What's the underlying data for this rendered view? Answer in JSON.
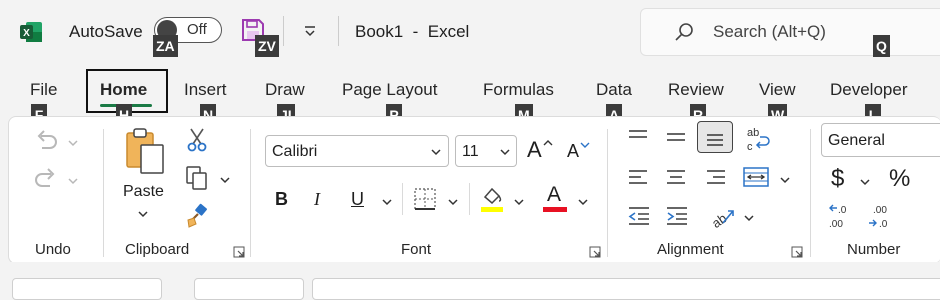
{
  "titlebar": {
    "autosave_label": "AutoSave",
    "autosave_state": "Off",
    "book_title": "Book1  -  Excel",
    "search_placeholder": "Search (Alt+Q)"
  },
  "keytips": {
    "autosave": "ZA",
    "save": "ZV",
    "search": "Q",
    "file": "F",
    "home": "H",
    "insert": "N",
    "draw": "JI",
    "page_layout": "P",
    "formulas": "M",
    "data": "A",
    "review": "R",
    "view": "W",
    "developer": "L"
  },
  "tabs": [
    "File",
    "Home",
    "Insert",
    "Draw",
    "Page Layout",
    "Formulas",
    "Data",
    "Review",
    "View",
    "Developer"
  ],
  "active_tab": "Home",
  "groups": {
    "undo": "Undo",
    "clipboard": "Clipboard",
    "paste": "Paste",
    "font": "Font",
    "alignment": "Alignment",
    "number": "Number"
  },
  "font": {
    "name": "Calibri",
    "size": "11",
    "bold": "B",
    "italic": "I",
    "underline": "U",
    "font_color": "A",
    "grow": "A",
    "shrink": "A"
  },
  "number": {
    "format": "General",
    "currency": "$",
    "percent": "%"
  },
  "colors": {
    "excel_green": "#1d7044",
    "active_underline": "#1a7a45",
    "highlight_yellow": "#ffff00",
    "font_red": "#e81123",
    "save_purple": "#9c3ab0"
  }
}
